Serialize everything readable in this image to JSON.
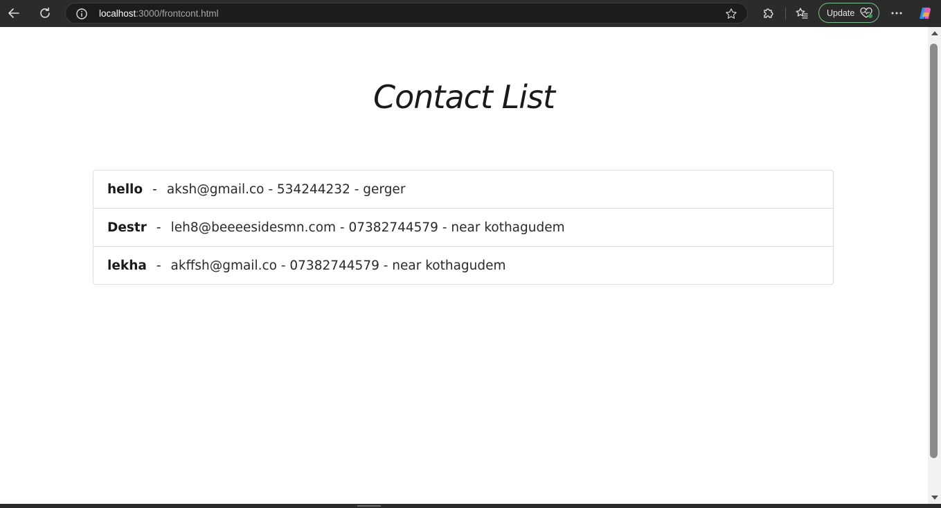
{
  "browser": {
    "url_host": "localhost",
    "url_path": ":3000/frontcont.html",
    "update_label": "Update"
  },
  "page": {
    "title": "Contact List"
  },
  "contacts": [
    {
      "name": "hello",
      "separator": "-",
      "details": "aksh@gmail.co - 534244232 - gerger"
    },
    {
      "name": "Destr",
      "separator": "-",
      "details": "leh8@beeeesidesmn.com - 07382744579 - near kothagudem"
    },
    {
      "name": "lekha",
      "separator": "-",
      "details": "akffsh@gmail.co - 07382744579 - near kothagudem"
    }
  ],
  "icons": {
    "back": "back-arrow-icon",
    "reload": "reload-icon",
    "site_info": "info-icon",
    "favorite": "star-icon",
    "extensions": "puzzle-icon",
    "favorites_list": "favorites-icon",
    "more": "more-icon",
    "copilot": "copilot-icon"
  },
  "colors": {
    "toolbar_bg": "#2b2b2b",
    "update_border": "#7fbf8c",
    "page_bg": "#ffffff",
    "list_border": "#dcdcdc"
  }
}
